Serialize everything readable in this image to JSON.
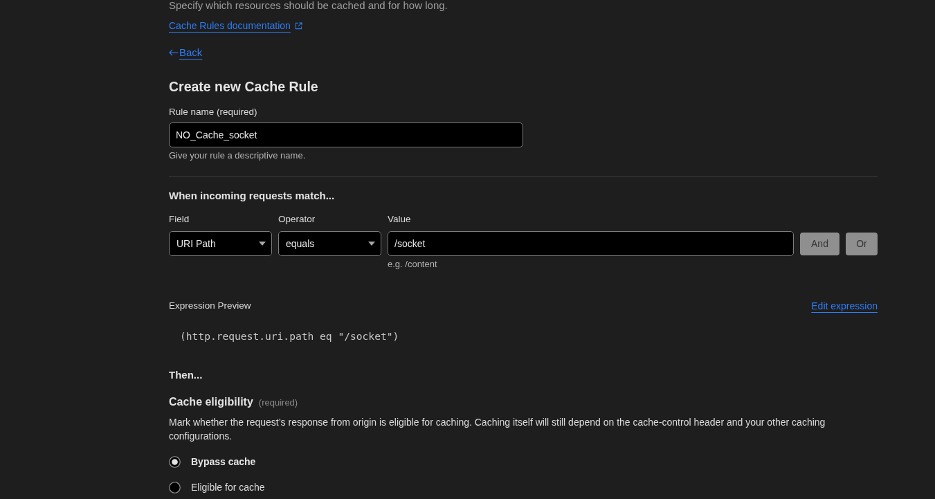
{
  "header": {
    "description": "Specify which resources should be cached and for how long.",
    "doc_link": "Cache Rules documentation"
  },
  "back_link": {
    "label": "Back"
  },
  "form": {
    "title": "Create new Cache Rule",
    "rule_name": {
      "label": "Rule name (required)",
      "value": "NO_Cache_socket",
      "hint": "Give your rule a descriptive name."
    }
  },
  "match": {
    "heading": "When incoming requests match...",
    "field": {
      "label": "Field",
      "value": "URI Path"
    },
    "operator": {
      "label": "Operator",
      "value": "equals"
    },
    "value": {
      "label": "Value",
      "value": "/socket",
      "hint": "e.g. /content"
    },
    "buttons": [
      {
        "label": "And",
        "disabled": true
      },
      {
        "label": "Or",
        "disabled": true
      }
    ]
  },
  "expression_preview": {
    "label": "Expression Preview",
    "edit_link": "Edit expression",
    "code": "(http.request.uri.path eq \"/socket\")"
  },
  "then": {
    "heading": "Then...",
    "cache_eligibility": {
      "title": "Cache eligibility",
      "required_note": "(required)",
      "description": "Mark whether the request’s response from origin is eligible for caching. Caching itself will still depend on the cache-control header and your other caching configurations.",
      "options": [
        {
          "label": "Bypass cache",
          "selected": true
        },
        {
          "label": "Eligible for cache",
          "selected": false
        }
      ]
    }
  }
}
